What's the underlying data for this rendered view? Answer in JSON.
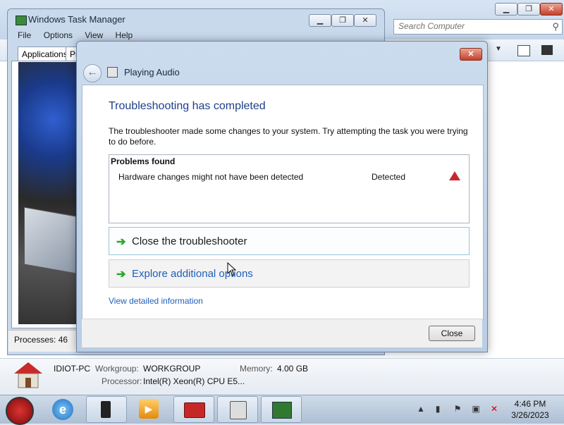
{
  "explorer": {
    "search_placeholder": "Search Computer",
    "window_controls": [
      "minimize",
      "maximize",
      "close"
    ]
  },
  "task_manager": {
    "title": "Windows Task Manager",
    "menu": [
      "File",
      "Options",
      "View",
      "Help"
    ],
    "tabs": [
      "Applications",
      "Pr"
    ],
    "processes_label": "Processes: 46"
  },
  "dialog": {
    "title": "Playing Audio",
    "heading": "Troubleshooting has completed",
    "description": "The troubleshooter made some changes to your system. Try attempting the task you were trying to do before.",
    "problems_header": "Problems found",
    "problems": [
      {
        "text": "Hardware changes might not have been detected",
        "status": "Detected",
        "icon": "warning-icon"
      }
    ],
    "options": [
      {
        "label": "Close the troubleshooter",
        "color": "#1a1a1a"
      },
      {
        "label": "Explore additional options",
        "color": "#1e5fb8"
      }
    ],
    "link": "View detailed information",
    "close_button": "Close"
  },
  "details": {
    "computer_name": "IDIOT-PC",
    "workgroup_label": "Workgroup:",
    "workgroup_value": "WORKGROUP",
    "memory_label": "Memory:",
    "memory_value": "4.00 GB",
    "processor_label": "Processor:",
    "processor_value": "Intel(R) Xeon(R) CPU E5..."
  },
  "taskbar": {
    "time": "4:46 PM",
    "date": "3/26/2023"
  }
}
